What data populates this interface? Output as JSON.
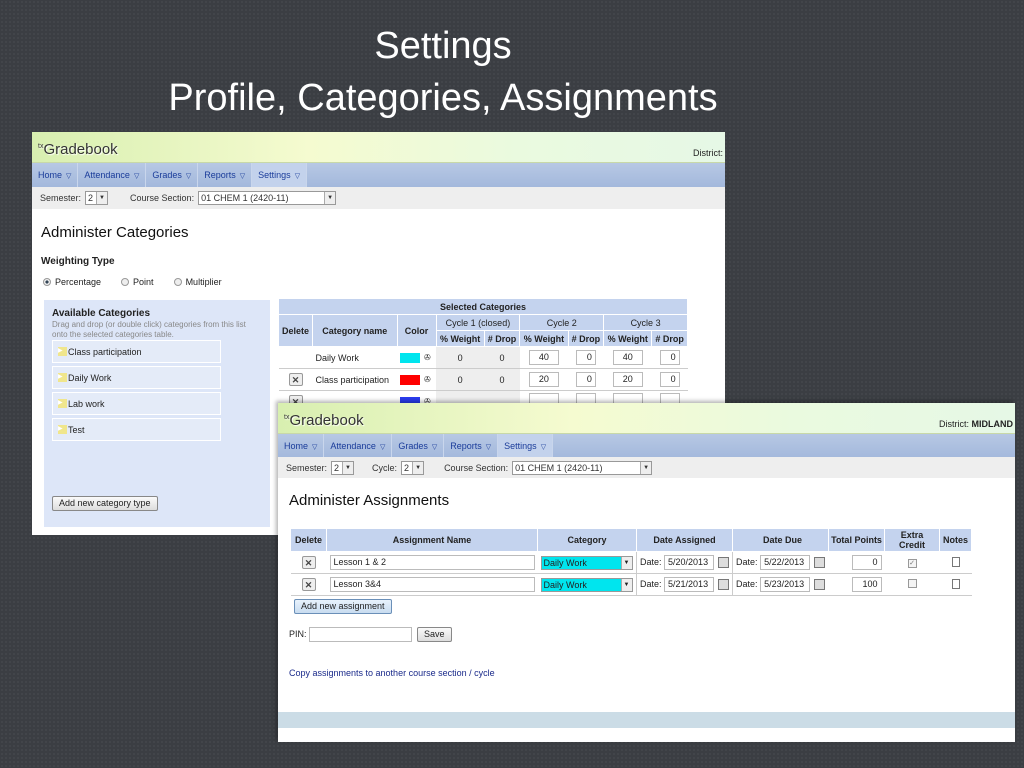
{
  "slide": {
    "title_line1": "Settings",
    "title_line2": "Profile, Categories, Assignments"
  },
  "colors": {
    "background": "#3b3e43",
    "nav": "#a3b8dc",
    "table_header": "#c4d3ee",
    "daily_work": "#00e5ee",
    "class_participation": "#ff0000",
    "third_category": "#2b3cf0"
  },
  "app": {
    "logo": "Gradebook",
    "logo_prefix": "tx",
    "district_label": "District:",
    "district_value": "MIDLAND",
    "nav": [
      {
        "label": "Home"
      },
      {
        "label": "Attendance"
      },
      {
        "label": "Grades"
      },
      {
        "label": "Reports"
      },
      {
        "label": "Settings"
      }
    ]
  },
  "categories_screen": {
    "semester_label": "Semester:",
    "semester": "2",
    "course_label": "Course Section:",
    "course": "01 CHEM 1 (2420-11)",
    "title": "Administer Categories",
    "weighting_label": "Weighting Type",
    "weighting_options": [
      {
        "label": "Percentage",
        "selected": true
      },
      {
        "label": "Point",
        "selected": false
      },
      {
        "label": "Multiplier",
        "selected": false
      }
    ],
    "available_title": "Available Categories",
    "available_hint": "Drag and drop (or double click) categories from this list onto the selected categories table.",
    "available": [
      "Class participation",
      "Daily Work",
      "Lab work",
      "Test"
    ],
    "add_button": "Add new category type",
    "selected_title": "Selected Categories",
    "headers": {
      "delete": "Delete",
      "name": "Category name",
      "color": "Color",
      "cycle1": "Cycle 1 (closed)",
      "cycle2": "Cycle 2",
      "cycle3": "Cycle 3",
      "weight": "% Weight",
      "drop": "# Drop"
    },
    "rows": [
      {
        "name": "Daily Work",
        "color": "#00e5ee",
        "deletable": false,
        "c1w": "0",
        "c1d": "0",
        "c2w": "40",
        "c2d": "0",
        "c3w": "40",
        "c3d": "0"
      },
      {
        "name": "Class participation",
        "color": "#ff0000",
        "deletable": true,
        "c1w": "0",
        "c1d": "0",
        "c2w": "20",
        "c2d": "0",
        "c3w": "20",
        "c3d": "0"
      },
      {
        "name": "",
        "color": "#2b3cf0",
        "deletable": true,
        "c1w": "",
        "c1d": "",
        "c2w": "",
        "c2d": "",
        "c3w": "",
        "c3d": ""
      }
    ]
  },
  "assignments_screen": {
    "semester_label": "Semester:",
    "semester": "2",
    "cycle_label": "Cycle:",
    "cycle": "2",
    "course_label": "Course Section:",
    "course": "01 CHEM 1 (2420-11)",
    "title": "Administer Assignments",
    "headers": {
      "delete": "Delete",
      "name": "Assignment Name",
      "category": "Category",
      "assigned": "Date Assigned",
      "due": "Date Due",
      "points": "Total Points",
      "extra": "Extra Credit",
      "notes": "Notes"
    },
    "date_label": "Date:",
    "rows": [
      {
        "name": "Lesson 1 & 2",
        "category": "Daily Work",
        "assigned": "5/20/2013",
        "due": "5/22/2013",
        "points": "0",
        "extra_credit": true
      },
      {
        "name": "Lesson 3&4",
        "category": "Daily Work",
        "assigned": "5/21/2013",
        "due": "5/23/2013",
        "points": "100",
        "extra_credit": false
      }
    ],
    "add_button": "Add new assignment",
    "pin_label": "PIN:",
    "pin_value": "",
    "save_button": "Save",
    "copy_link": "Copy assignments to another course section / cycle"
  }
}
